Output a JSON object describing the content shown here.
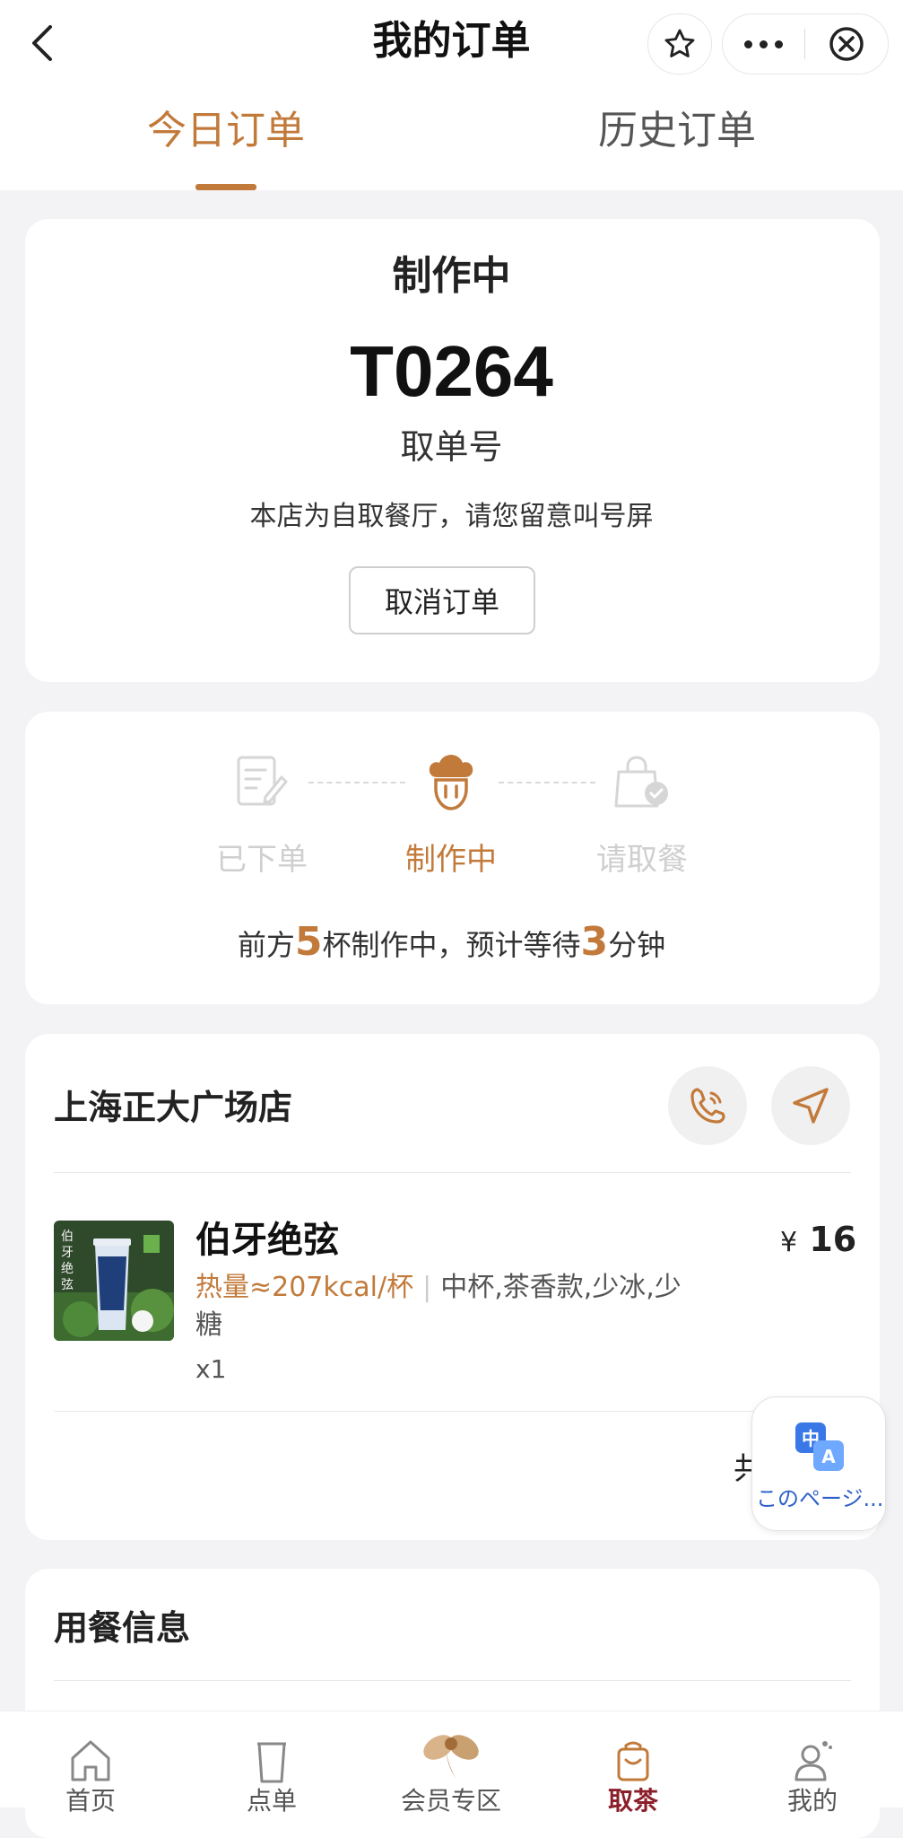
{
  "header": {
    "title": "我的订单",
    "tabs": [
      {
        "label": "今日订单",
        "active": true
      },
      {
        "label": "历史订单",
        "active": false
      }
    ]
  },
  "order": {
    "status": "制作中",
    "pickup_number": "T0264",
    "pickup_label": "取单号",
    "notice": "本店为自取餐厅，请您留意叫号屏",
    "cancel_label": "取消订单"
  },
  "progress": {
    "steps": [
      {
        "label": "已下单",
        "state": "done"
      },
      {
        "label": "制作中",
        "state": "current"
      },
      {
        "label": "请取餐",
        "state": "pending"
      }
    ],
    "wait_prefix": "前方",
    "cups_ahead": "5",
    "wait_mid": "杯制作中，预计等待",
    "wait_minutes": "3",
    "wait_suffix": "分钟"
  },
  "store": {
    "name": "上海正大广场店",
    "phone_icon": "phone-icon",
    "navigate_icon": "navigate-icon"
  },
  "product": {
    "name": "伯牙绝弦",
    "currency": "¥",
    "price": "16",
    "calories": "热量≈207kcal/杯",
    "spec": "中杯,茶香款,少冰,少糖",
    "quantity": "x1",
    "image_icon": "tea-cup-image"
  },
  "total_fragment": "共",
  "translate_bubble": {
    "label": "このページ..."
  },
  "dining": {
    "title": "用餐信息"
  },
  "bottom_nav": [
    {
      "label": "首页",
      "icon": "home-icon",
      "active": false
    },
    {
      "label": "点单",
      "icon": "cup-icon",
      "active": false
    },
    {
      "label": "会员专区",
      "icon": "fairy-icon",
      "active": false
    },
    {
      "label": "取茶",
      "icon": "bag-icon",
      "active": true
    },
    {
      "label": "我的",
      "icon": "user-icon",
      "active": false
    }
  ],
  "colors": {
    "accent": "#c27a3b",
    "nav_active": "#8a1f2b",
    "background": "#f3f2f5"
  }
}
